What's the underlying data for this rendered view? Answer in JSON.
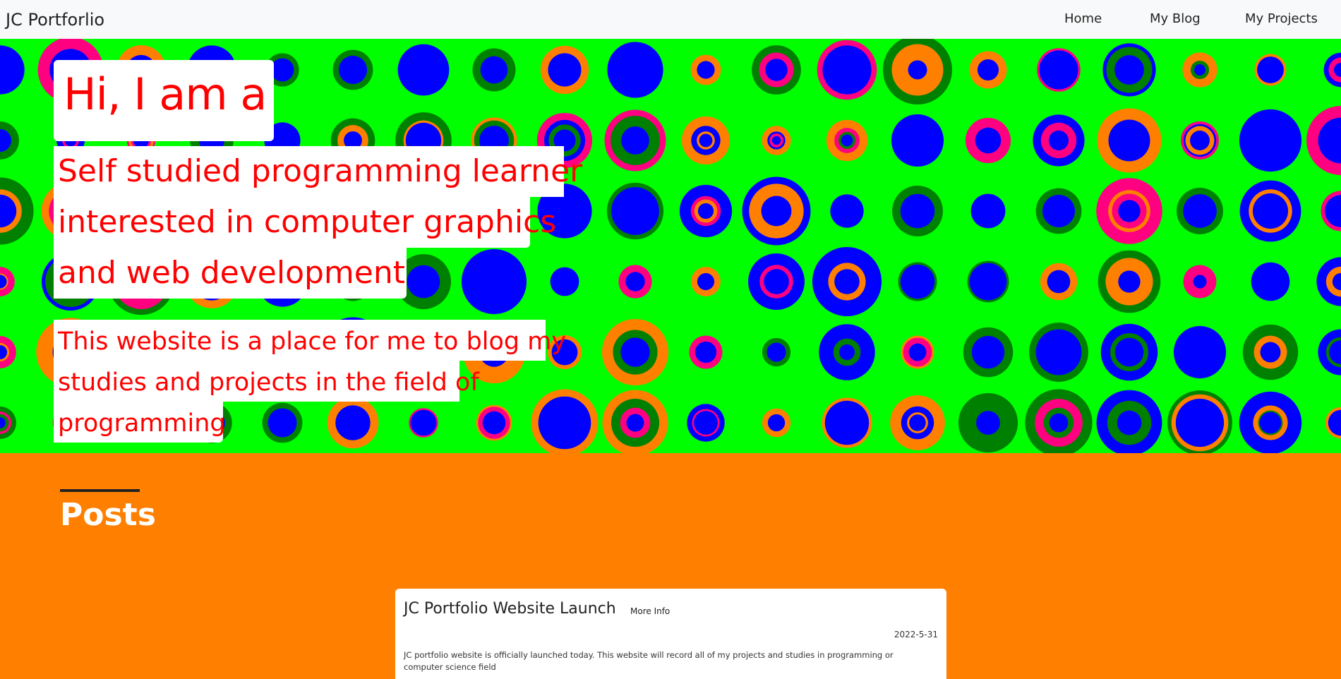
{
  "nav": {
    "brand": "JC Portforlio",
    "links": [
      {
        "label": "Home"
      },
      {
        "label": "My Blog"
      },
      {
        "label": "My Projects"
      }
    ]
  },
  "hero": {
    "heading": "Hi, I am a",
    "subtitle_lines": [
      "Self studied programming learner",
      "interested in computer graphics",
      "and web development"
    ],
    "description_lines": [
      "This website is a place for me to blog my",
      "studies and projects in the field of",
      "programming"
    ],
    "colors": {
      "background": "#00ff00",
      "blue": "#0000ff",
      "pink": "#ff0080",
      "orange": "#ff8000",
      "green": "#008000",
      "text": "#ff0000"
    }
  },
  "posts": {
    "heading": "Posts",
    "items": [
      {
        "title": "JC Portfolio Website Launch",
        "more_label": "More Info",
        "date": "2022-5-31",
        "body": "JC portfolio website is officially launched today. This website will record all of my projects and studies in programming or computer science field"
      }
    ],
    "colors": {
      "background": "#ff8000"
    }
  }
}
